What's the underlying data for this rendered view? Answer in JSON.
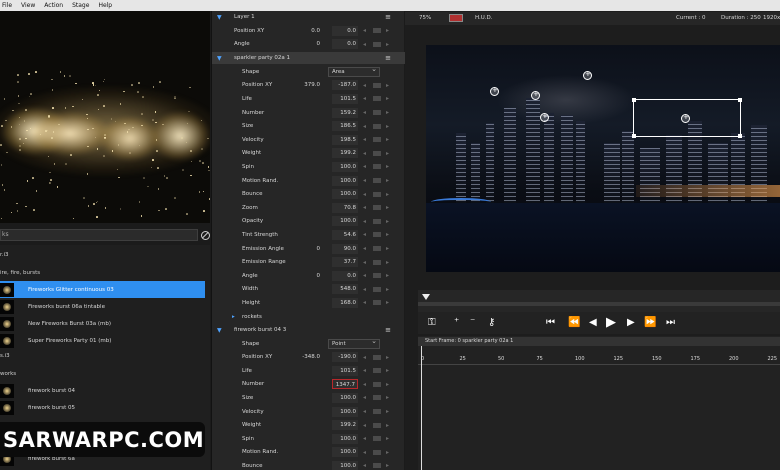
{
  "menu": [
    "File",
    "View",
    "Action",
    "Stage",
    "Help"
  ],
  "search": {
    "value": "ks"
  },
  "library": {
    "categories": [
      "r.i3",
      "ire, fire, bursts",
      "s.i3",
      "works"
    ],
    "items": [
      {
        "label": "Fireworks Glitter continuous 03",
        "selected": true
      },
      {
        "label": "Fireworks burst 06a tintable",
        "selected": false
      },
      {
        "label": "New Fireworks Burst 03a (mb)",
        "selected": false
      },
      {
        "label": "Super Fireworks Party 01 (mb)",
        "selected": false
      },
      {
        "label": "firework burst 04",
        "selected": false
      },
      {
        "label": "firework burst 05",
        "selected": false
      },
      {
        "label": "firework burst 6a",
        "selected": false
      }
    ]
  },
  "watermark": "SARWARPC.COM",
  "layer": {
    "name": "Layer 1",
    "rows": [
      {
        "label": "Position XY",
        "v1": "0.0",
        "v2": "0.0"
      },
      {
        "label": "Angle",
        "v1": "0",
        "v2": "0.0"
      }
    ]
  },
  "emitter1": {
    "name": "sparkler party 02a 1",
    "shape_label": "Shape",
    "shape_value": "Area",
    "rows": [
      {
        "label": "Position XY",
        "v1": "379.0",
        "v2": "-187.0"
      },
      {
        "label": "Life",
        "v1": "",
        "v2": "101.5"
      },
      {
        "label": "Number",
        "v1": "",
        "v2": "159.2"
      },
      {
        "label": "Size",
        "v1": "",
        "v2": "186.5"
      },
      {
        "label": "Velocity",
        "v1": "",
        "v2": "198.5"
      },
      {
        "label": "Weight",
        "v1": "",
        "v2": "199.2"
      },
      {
        "label": "Spin",
        "v1": "",
        "v2": "100.0"
      },
      {
        "label": "Motion Rand.",
        "v1": "",
        "v2": "100.0"
      },
      {
        "label": "Bounce",
        "v1": "",
        "v2": "100.0"
      },
      {
        "label": "Zoom",
        "v1": "",
        "v2": "70.8"
      },
      {
        "label": "Opacity",
        "v1": "",
        "v2": "100.0"
      },
      {
        "label": "Tint Strength",
        "v1": "",
        "v2": "54.6"
      },
      {
        "label": "Emission Angle",
        "v1": "0",
        "v2": "90.0"
      },
      {
        "label": "Emission Range",
        "v1": "",
        "v2": "37.7"
      },
      {
        "label": "Angle",
        "v1": "0",
        "v2": "0.0"
      },
      {
        "label": "Width",
        "v1": "",
        "v2": "548.0"
      },
      {
        "label": "Height",
        "v1": "",
        "v2": "168.0"
      }
    ],
    "sub": "rockets"
  },
  "emitter2": {
    "name": "firework burst 04 3",
    "shape_label": "Shape",
    "shape_value": "Point",
    "rows": [
      {
        "label": "Position XY",
        "v1": "-348.0",
        "v2": "-190.0"
      },
      {
        "label": "Life",
        "v1": "",
        "v2": "101.5"
      },
      {
        "label": "Number",
        "v1": "",
        "v2": "1347.7"
      },
      {
        "label": "Size",
        "v1": "",
        "v2": "100.0"
      },
      {
        "label": "Velocity",
        "v1": "",
        "v2": "100.0"
      },
      {
        "label": "Weight",
        "v1": "",
        "v2": "199.2"
      },
      {
        "label": "Spin",
        "v1": "",
        "v2": "100.0"
      },
      {
        "label": "Motion Rand.",
        "v1": "",
        "v2": "100.0"
      },
      {
        "label": "Bounce",
        "v1": "",
        "v2": "100.0"
      }
    ]
  },
  "viewer": {
    "zoom": "75%",
    "hud": "H.U.D.",
    "current": "Current : 0",
    "duration": "Duration : 250",
    "fps": "1920x"
  },
  "timeline": {
    "header": "Start Frame: 0 sparkler party 02a 1",
    "ticks": [
      "0",
      "25",
      "50",
      "75",
      "100",
      "125",
      "150",
      "175",
      "200",
      "225"
    ]
  }
}
